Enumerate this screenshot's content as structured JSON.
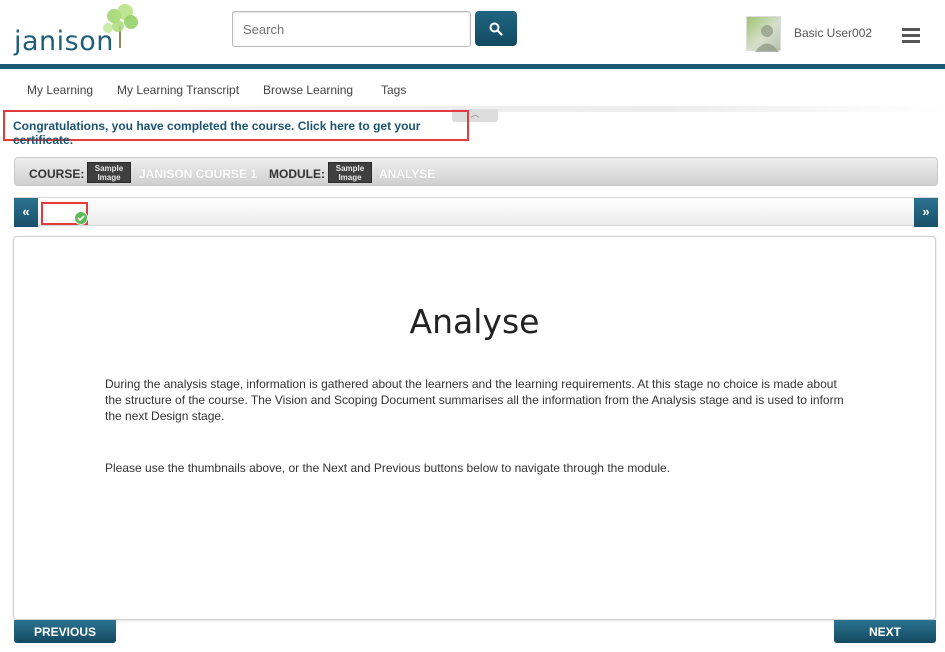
{
  "header": {
    "logo_text": "janison",
    "search": {
      "placeholder": "Search",
      "value": ""
    },
    "user": {
      "name": "Basic User002"
    }
  },
  "nav": {
    "items": [
      {
        "label": "My Learning"
      },
      {
        "label": "My Learning Transcript"
      },
      {
        "label": "Browse Learning"
      },
      {
        "label": "Tags"
      }
    ]
  },
  "alert": {
    "text": "Congratulations, you have completed the course. Click here to get your certificate."
  },
  "course_bar": {
    "course_label": "COURSE:",
    "course_thumb": "Sample Image",
    "course_name": "JANISON COURSE 1",
    "module_label": "MODULE:",
    "module_thumb": "Sample Image",
    "module_name": "ANALYSE"
  },
  "strip": {
    "prev_label": "«",
    "next_label": "»"
  },
  "content": {
    "title": "Analyse",
    "paragraph1": "During the analysis stage, information is gathered about the learners and the learning requirements. At this stage no choice is made about the structure of the course. The Vision and Scoping Document summarises all the information from the Analysis stage and is used to inform the next Design stage.",
    "paragraph2": "Please use the thumbnails above, or the Next and Previous buttons below to navigate through the module."
  },
  "footer": {
    "previous_label": "PREVIOUS",
    "next_label": "NEXT"
  },
  "colors": {
    "brand": "#1c5b74",
    "alert_border": "#e23b3b",
    "complete": "#5fb85a"
  }
}
